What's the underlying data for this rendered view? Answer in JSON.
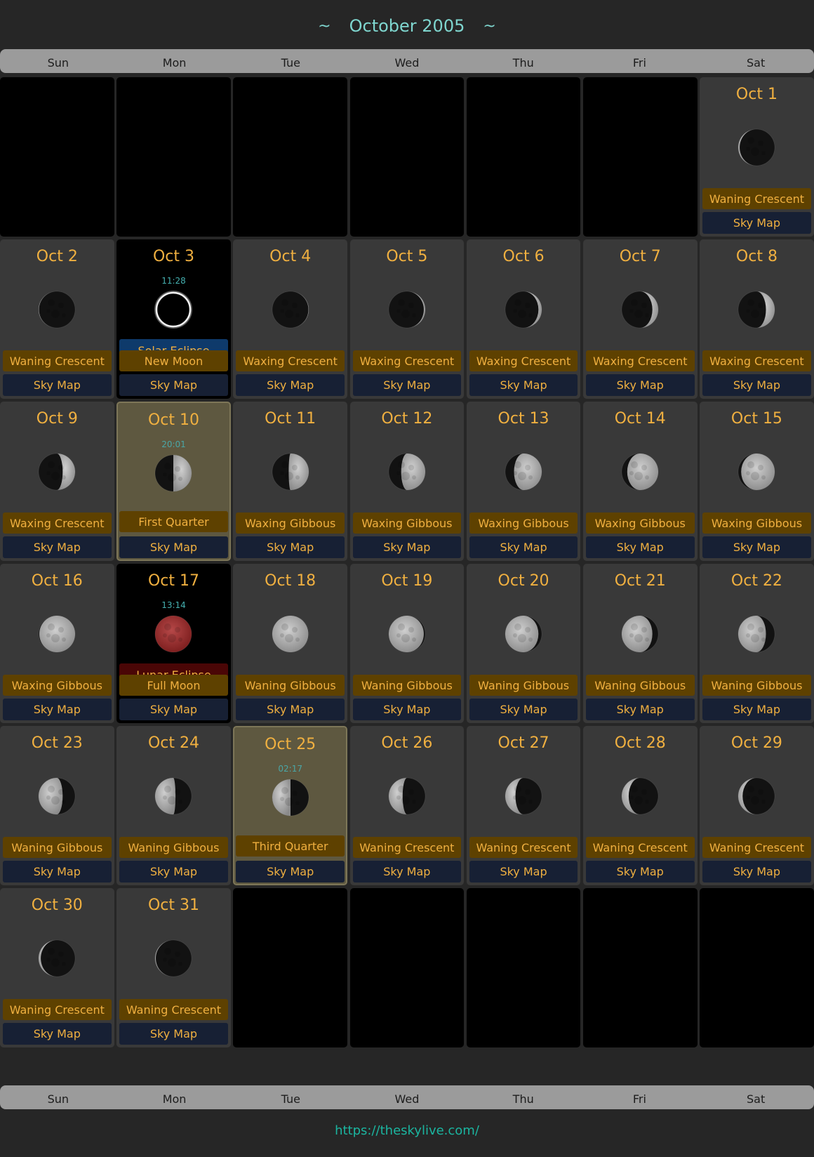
{
  "header": {
    "title": "October 2005",
    "left_glyph": "~",
    "right_glyph": "~"
  },
  "weekdays": [
    "Sun",
    "Mon",
    "Tue",
    "Wed",
    "Thu",
    "Fri",
    "Sat"
  ],
  "sky_map_label": "Sky Map",
  "footer": {
    "link": "https://theskylive.com/"
  },
  "colors": {
    "accent": "#f0b040",
    "phase_bg": "#5e4100",
    "skymap_bg": "#172034",
    "quarter_bg": "#5e5840",
    "link": "#1bb5a0"
  },
  "leading_empty_cells": 6,
  "trailing_empty_cells": 5,
  "days": [
    {
      "date": "Oct 1",
      "phase": "Waning Crescent",
      "illum": 0.04,
      "waxing": false
    },
    {
      "date": "Oct 2",
      "phase": "Waning Crescent",
      "illum": 0.01,
      "waxing": false
    },
    {
      "date": "Oct 3",
      "phase": "New Moon",
      "time": "11:28",
      "event": "Solar Eclipse",
      "illum": 0.0,
      "waxing": true
    },
    {
      "date": "Oct 4",
      "phase": "Waxing Crescent",
      "illum": 0.01,
      "waxing": true
    },
    {
      "date": "Oct 5",
      "phase": "Waxing Crescent",
      "illum": 0.04,
      "waxing": true
    },
    {
      "date": "Oct 6",
      "phase": "Waxing Crescent",
      "illum": 0.09,
      "waxing": true
    },
    {
      "date": "Oct 7",
      "phase": "Waxing Crescent",
      "illum": 0.16,
      "waxing": true
    },
    {
      "date": "Oct 8",
      "phase": "Waxing Crescent",
      "illum": 0.24,
      "waxing": true
    },
    {
      "date": "Oct 9",
      "phase": "Waxing Crescent",
      "illum": 0.34,
      "waxing": true
    },
    {
      "date": "Oct 10",
      "phase": "First Quarter",
      "time": "20:01",
      "illum": 0.5,
      "waxing": true
    },
    {
      "date": "Oct 11",
      "phase": "Waxing Gibbous",
      "illum": 0.55,
      "waxing": true
    },
    {
      "date": "Oct 12",
      "phase": "Waxing Gibbous",
      "illum": 0.66,
      "waxing": true
    },
    {
      "date": "Oct 13",
      "phase": "Waxing Gibbous",
      "illum": 0.76,
      "waxing": true
    },
    {
      "date": "Oct 14",
      "phase": "Waxing Gibbous",
      "illum": 0.85,
      "waxing": true
    },
    {
      "date": "Oct 15",
      "phase": "Waxing Gibbous",
      "illum": 0.92,
      "waxing": true
    },
    {
      "date": "Oct 16",
      "phase": "Waxing Gibbous",
      "illum": 0.98,
      "waxing": true
    },
    {
      "date": "Oct 17",
      "phase": "Full Moon",
      "time": "13:14",
      "event": "Lunar Eclipse",
      "illum": 1.0,
      "waxing": false
    },
    {
      "date": "Oct 18",
      "phase": "Waning Gibbous",
      "illum": 0.99,
      "waxing": false
    },
    {
      "date": "Oct 19",
      "phase": "Waning Gibbous",
      "illum": 0.96,
      "waxing": false
    },
    {
      "date": "Oct 20",
      "phase": "Waning Gibbous",
      "illum": 0.91,
      "waxing": false
    },
    {
      "date": "Oct 21",
      "phase": "Waning Gibbous",
      "illum": 0.84,
      "waxing": false
    },
    {
      "date": "Oct 22",
      "phase": "Waning Gibbous",
      "illum": 0.76,
      "waxing": false
    },
    {
      "date": "Oct 23",
      "phase": "Waning Gibbous",
      "illum": 0.66,
      "waxing": false
    },
    {
      "date": "Oct 24",
      "phase": "Waning Gibbous",
      "illum": 0.56,
      "waxing": false
    },
    {
      "date": "Oct 25",
      "phase": "Third Quarter",
      "time": "02:17",
      "illum": 0.5,
      "waxing": false
    },
    {
      "date": "Oct 26",
      "phase": "Waning Crescent",
      "illum": 0.38,
      "waxing": false
    },
    {
      "date": "Oct 27",
      "phase": "Waning Crescent",
      "illum": 0.28,
      "waxing": false
    },
    {
      "date": "Oct 28",
      "phase": "Waning Crescent",
      "illum": 0.19,
      "waxing": false
    },
    {
      "date": "Oct 29",
      "phase": "Waning Crescent",
      "illum": 0.12,
      "waxing": false
    },
    {
      "date": "Oct 30",
      "phase": "Waning Crescent",
      "illum": 0.06,
      "waxing": false
    },
    {
      "date": "Oct 31",
      "phase": "Waning Crescent",
      "illum": 0.02,
      "waxing": false
    }
  ]
}
